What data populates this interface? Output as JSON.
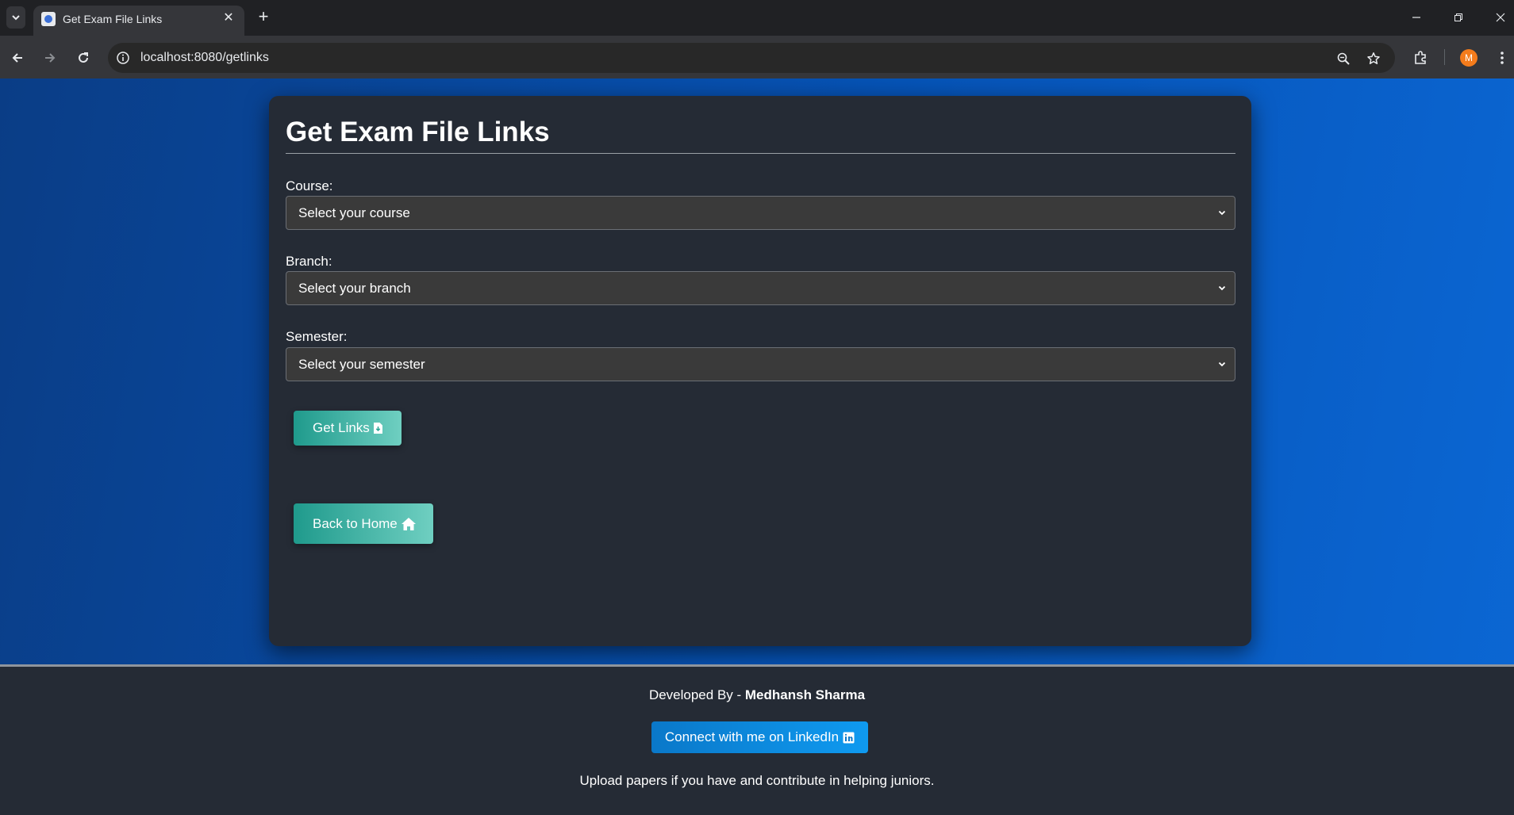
{
  "browser": {
    "tab_title": "Get Exam File Links",
    "url": "localhost:8080/getlinks",
    "profile_initial": "M"
  },
  "page": {
    "title": "Get Exam File Links",
    "course": {
      "label": "Course:",
      "selected": "Select your course"
    },
    "branch": {
      "label": "Branch:",
      "selected": "Select your branch"
    },
    "semester": {
      "label": "Semester:",
      "selected": "Select your semester"
    },
    "get_links_label": "Get Links",
    "back_home_label": "Back to Home"
  },
  "footer": {
    "developed_by_prefix": "Developed By - ",
    "developer_name": "Medhansh Sharma",
    "linkedin_label": "Connect with me on LinkedIn",
    "upload_note": "Upload papers if you have and contribute in helping juniors."
  },
  "colors": {
    "page_gradient_start": "#0a3d86",
    "page_gradient_end": "#0b67d4",
    "card_bg": "#252b35",
    "teal_button": "#1f9a8c",
    "linkedin_blue": "#0a78c9",
    "profile_orange": "#f47c1c"
  },
  "icons": {
    "get_links": "file-download-icon",
    "back_home": "home-icon",
    "linkedin": "linkedin-icon"
  }
}
